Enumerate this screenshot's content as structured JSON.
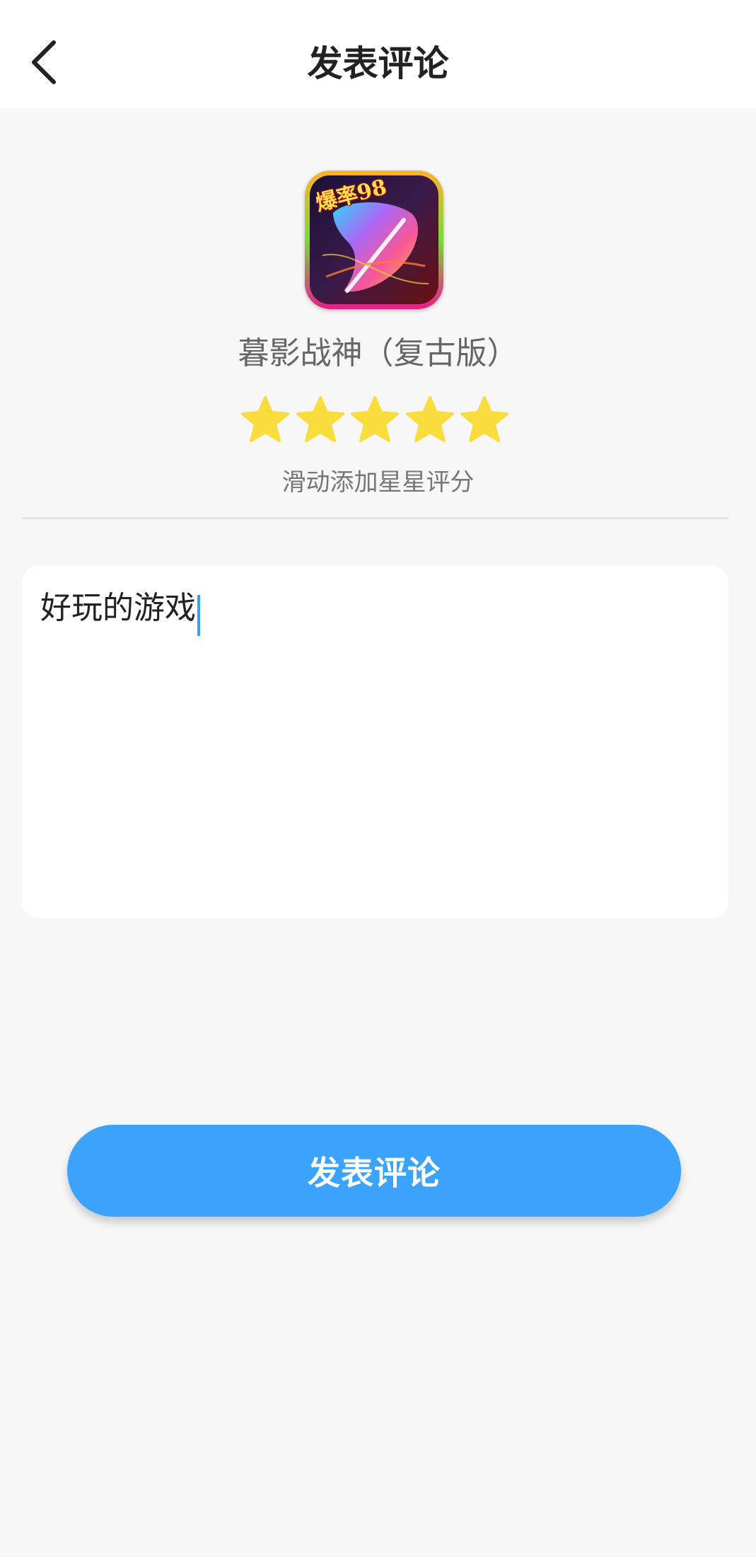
{
  "header": {
    "title": "发表评论"
  },
  "game": {
    "name": "暮影战神（复古版）",
    "icon_text": "爆率98"
  },
  "rating": {
    "stars": 5,
    "max": 5,
    "star_color": "#f9dd3c",
    "hint": "滑动添加星星评分"
  },
  "comment": {
    "value": "好玩的游戏"
  },
  "submit": {
    "label": "发表评论",
    "color": "#3ba3fb"
  },
  "icons": {
    "back": "chevron-left-icon",
    "star": "star-icon"
  }
}
